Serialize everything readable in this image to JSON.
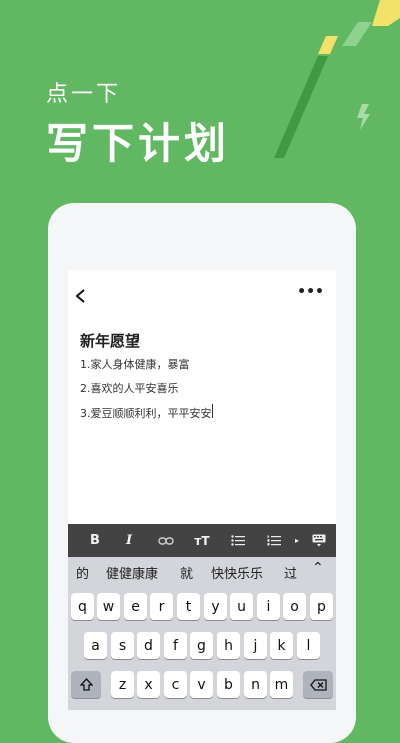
{
  "headline": {
    "small": "点一下",
    "big": "写下计划"
  },
  "editor": {
    "title": "新年愿望",
    "lines": [
      "1.家人身体健康，暴富",
      "2.喜欢的人平安喜乐",
      "3.爱豆顺顺利利，平平安安"
    ]
  },
  "toolbar": {
    "bold": "B",
    "italic": "I",
    "text_size": "тT"
  },
  "keyboard": {
    "suggestions": [
      "的",
      "健健康康",
      "就",
      "快快乐乐",
      "过"
    ],
    "row1": [
      "q",
      "w",
      "e",
      "r",
      "t",
      "y",
      "u",
      "i",
      "o",
      "p"
    ],
    "row2": [
      "a",
      "s",
      "d",
      "f",
      "g",
      "h",
      "j",
      "k",
      "l"
    ],
    "row3": [
      "z",
      "x",
      "c",
      "v",
      "b",
      "n",
      "m"
    ]
  },
  "colors": {
    "background": "#62b862",
    "accent_yellow": "#f3e26a",
    "toolbar": "#434343"
  }
}
